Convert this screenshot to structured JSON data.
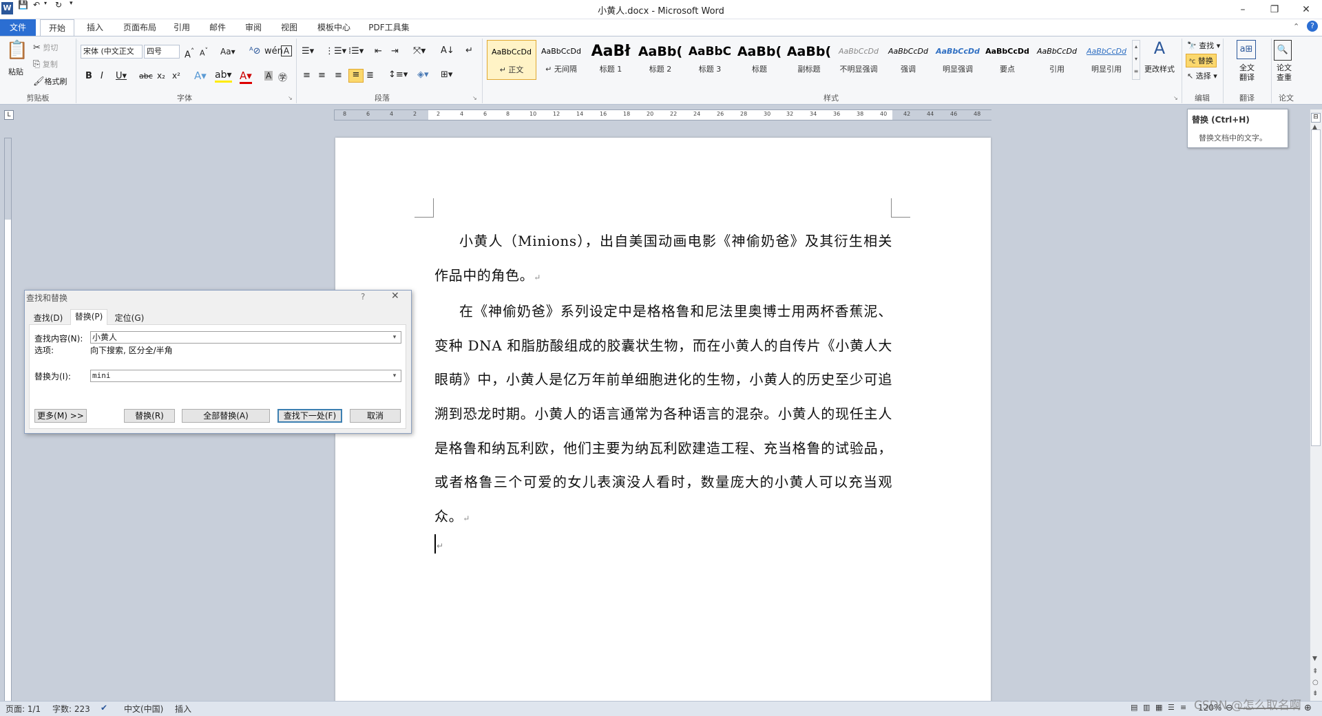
{
  "window": {
    "title": "小黄人.docx - Microsoft Word",
    "app_icon": "W"
  },
  "tabs": [
    "文件",
    "开始",
    "插入",
    "页面布局",
    "引用",
    "邮件",
    "审阅",
    "视图",
    "模板中心",
    "PDF工具集"
  ],
  "clipboard": {
    "paste": "粘贴",
    "cut": "剪切",
    "copy": "复制",
    "format_painter": "格式刷",
    "group": "剪贴板"
  },
  "font": {
    "name": "宋体 (中文正⽂",
    "size": "四号",
    "group": "字体"
  },
  "paragraph": {
    "group": "段落"
  },
  "styles": {
    "group": "样式",
    "items": [
      {
        "preview": "AaBbCcDd",
        "name": "↵ 正文"
      },
      {
        "preview": "AaBbCcDd",
        "name": "↵ 无间隔"
      },
      {
        "preview": "AaBł",
        "name": "标题 1"
      },
      {
        "preview": "AaBb(",
        "name": "标题 2"
      },
      {
        "preview": "AaBbC",
        "name": "标题 3"
      },
      {
        "preview": "AaBb(",
        "name": "标题"
      },
      {
        "preview": "AaBb(",
        "name": "副标题"
      },
      {
        "preview": "AaBbCcDd",
        "name": "不明显强调"
      },
      {
        "preview": "AaBbCcDd",
        "name": "强调"
      },
      {
        "preview": "AaBbCcDd",
        "name": "明显强调"
      },
      {
        "preview": "AaBbCcDd",
        "name": "要点"
      },
      {
        "preview": "AaBbCcDd",
        "name": "引用"
      },
      {
        "preview": "AaBbCcDd",
        "name": "明显引用"
      }
    ],
    "change_styles": "更改样式"
  },
  "editing": {
    "find": "查找",
    "replace": "替换",
    "select": "选择",
    "group": "编辑"
  },
  "translate": {
    "full": "全文\n翻译",
    "group": "翻译"
  },
  "paper": {
    "check": "论文\n查重",
    "group": "论文"
  },
  "tooltip": {
    "title": "替换 (Ctrl+H)",
    "desc": "替换文档中的文字。"
  },
  "ruler": {
    "numbers": [
      "8",
      "6",
      "4",
      "2",
      "2",
      "4",
      "6",
      "8",
      "10",
      "12",
      "14",
      "16",
      "18",
      "20",
      "22",
      "24",
      "26",
      "28",
      "30",
      "32",
      "34",
      "36",
      "38",
      "40",
      "42",
      "44",
      "46",
      "48"
    ]
  },
  "document": {
    "p1": "小黄人（Minions），出自美国动画电影《神偷奶爸》及其衍生相关作品中的角色。",
    "p2": "在《神偷奶爸》系列设定中是格格鲁和尼法里奥博士用两杯香蕉泥、变种 DNA 和脂肪酸组成的胶囊状生物，而在小黄人的自传片《小黄人大眼萌》中，小黄人是亿万年前单细胞进化的生物，小黄人的历史至少可追溯到恐龙时期。小黄人的语言通常为各种语言的混杂。小黄人的现任主人是格鲁和纳瓦利欧，他们主要为纳瓦利欧建造工程、充当格鲁的试验品，或者格鲁三个可爱的女儿表演没人看时，数量庞大的小黄人可以充当观众。",
    "para_mark": "↵"
  },
  "dialog": {
    "title": "查找和替换",
    "help": "?",
    "tabs": [
      "查找(D)",
      "替换(P)",
      "定位(G)"
    ],
    "find_label": "查找内容(N):",
    "find_value": "小黄人",
    "options_label": "选项:",
    "options_value": "向下搜索, 区分全/半角",
    "replace_label": "替换为(I):",
    "replace_value": "mini",
    "buttons": {
      "more": "更多(M) >>",
      "replace": "替换(R)",
      "replace_all": "全部替换(A)",
      "find_next": "查找下一处(F)",
      "cancel": "取消"
    }
  },
  "status": {
    "page": "页面: 1/1",
    "words": "字数: 223",
    "lang": "中文(中国)",
    "mode": "插入",
    "zoom": "120%",
    "watermark": "CSDN @怎么取名啊"
  }
}
